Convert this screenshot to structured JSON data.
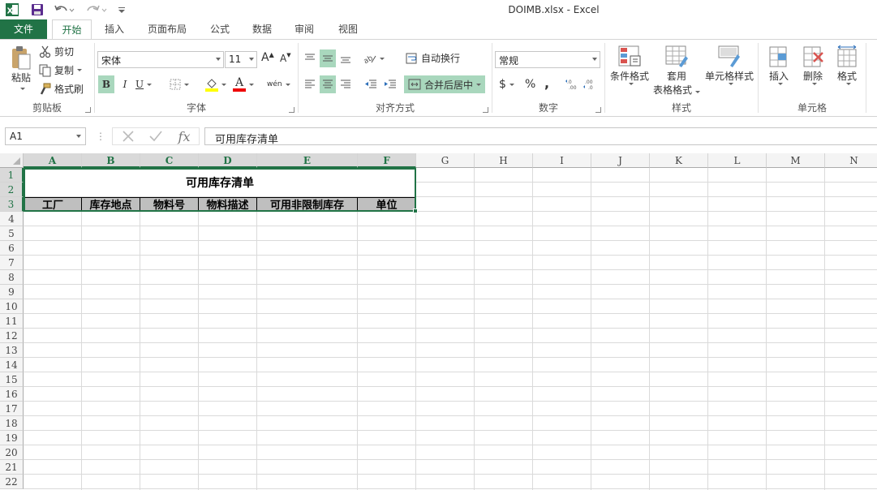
{
  "window": {
    "title": "DOIMB.xlsx - Excel"
  },
  "tabs": {
    "file": "文件",
    "home": "开始",
    "insert": "插入",
    "layout": "页面布局",
    "formula": "公式",
    "data": "数据",
    "review": "审阅",
    "view": "视图"
  },
  "ribbon": {
    "clipboard": {
      "label": "剪贴板",
      "paste": "粘贴",
      "cut": "剪切",
      "copy": "复制",
      "format_painter": "格式刷"
    },
    "font": {
      "label": "字体",
      "font_name": "宋体",
      "font_size": "11",
      "bold": "B",
      "italic": "I",
      "underline": "U",
      "grow": "A",
      "shrink": "A",
      "font_color_glyph": "A",
      "phonetic": "wén"
    },
    "alignment": {
      "label": "对齐方式",
      "wrap_text": "自动换行",
      "merge_center": "合并后居中"
    },
    "number": {
      "label": "数字",
      "format": "常规",
      "currency": "$",
      "percent": "%",
      "comma": ","
    },
    "styles": {
      "label": "样式",
      "conditional": "条件格式",
      "table_line1": "套用",
      "table_line2": "表格格式",
      "cell_styles": "单元格样式"
    },
    "cells": {
      "label": "单元格",
      "insert": "插入",
      "delete": "删除",
      "format": "格式"
    }
  },
  "formula_bar": {
    "name_box": "A1",
    "fx": "fx",
    "content": "可用库存清单"
  },
  "grid": {
    "columns": [
      "A",
      "B",
      "C",
      "D",
      "E",
      "F",
      "G",
      "H",
      "I",
      "J",
      "K",
      "L",
      "M",
      "N"
    ],
    "rows": [
      "1",
      "2",
      "3",
      "4",
      "5",
      "6",
      "7",
      "8",
      "9",
      "10",
      "11",
      "12",
      "13",
      "14",
      "15",
      "16",
      "17",
      "18",
      "19",
      "20",
      "21",
      "22"
    ],
    "title": "可用库存清单",
    "headers": [
      "工厂",
      "库存地点",
      "物料号",
      "物料描述",
      "可用非限制库存",
      "单位"
    ]
  },
  "colors": {
    "accent": "#217346",
    "header_fill": "#bfbfbf",
    "selected_button": "#a9d7bd"
  }
}
